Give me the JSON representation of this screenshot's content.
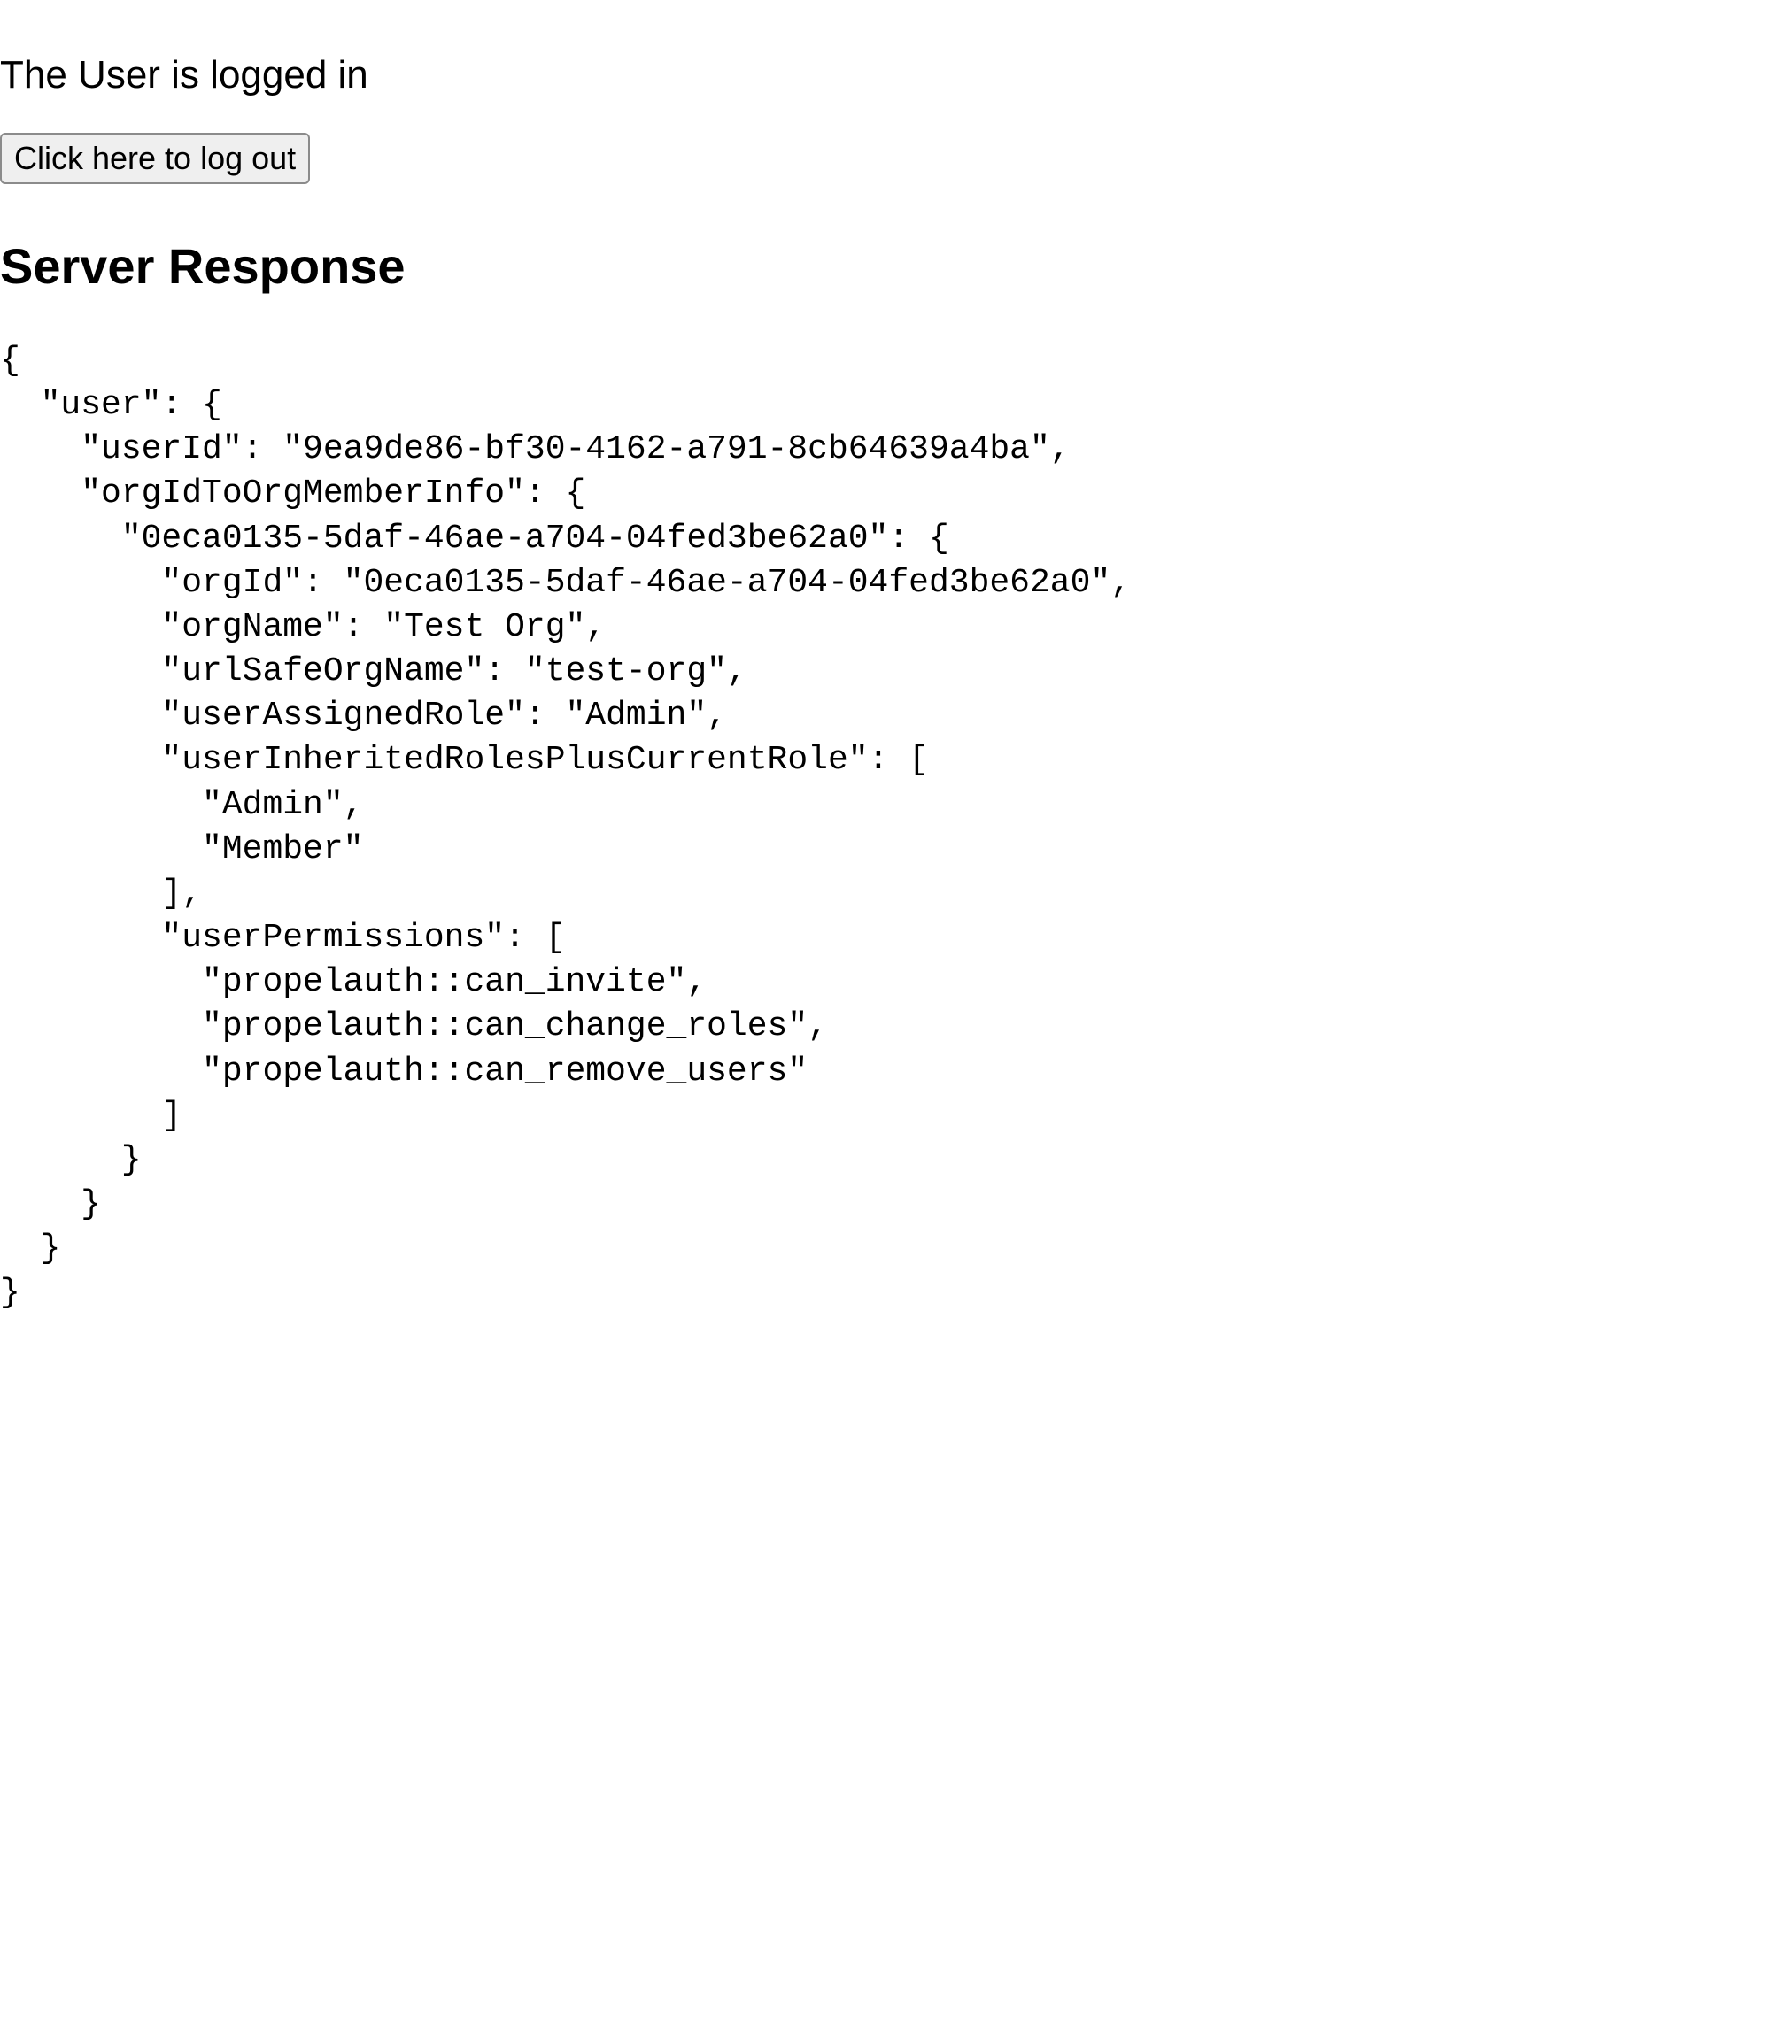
{
  "status_text": "The User is logged in",
  "logout_button_label": "Click here to log out",
  "section_heading": "Server Response",
  "server_response": {
    "user": {
      "userId": "9ea9de86-bf30-4162-a791-8cb64639a4ba",
      "orgIdToOrgMemberInfo": {
        "0eca0135-5daf-46ae-a704-04fed3be62a0": {
          "orgId": "0eca0135-5daf-46ae-a704-04fed3be62a0",
          "orgName": "Test Org",
          "urlSafeOrgName": "test-org",
          "userAssignedRole": "Admin",
          "userInheritedRolesPlusCurrentRole": [
            "Admin",
            "Member"
          ],
          "userPermissions": [
            "propelauth::can_invite",
            "propelauth::can_change_roles",
            "propelauth::can_remove_users"
          ]
        }
      }
    }
  }
}
